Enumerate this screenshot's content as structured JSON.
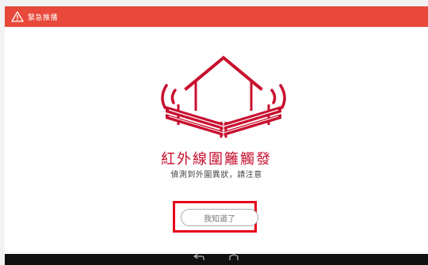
{
  "header": {
    "icon": "warning-triangle-icon",
    "title": "緊急推播",
    "background_color": "#e8493a"
  },
  "alert": {
    "illustration_icon": "house-boundary-alarm-icon",
    "title": "紅外線圍籬觸發",
    "subtitle": "偵測到外圍異狀，請注意",
    "accent_color": "#c8102e"
  },
  "actions": {
    "acknowledge_label": "我知道了",
    "highlight_color": "#e6001a"
  },
  "navigation_bar": {
    "back_icon": "back-arrow-icon",
    "home_icon": "home-icon"
  }
}
